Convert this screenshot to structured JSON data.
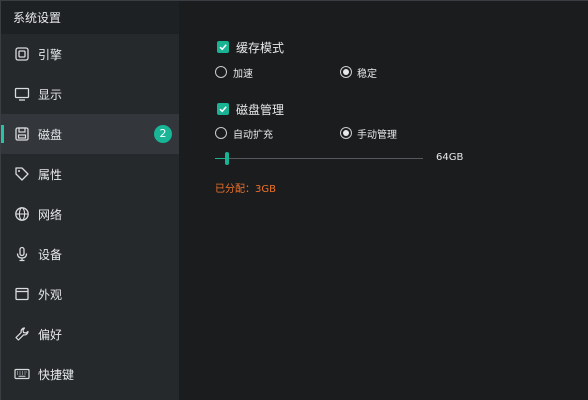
{
  "window": {
    "title": "系统设置"
  },
  "sidebar": {
    "items": [
      {
        "label": "引擎",
        "icon": "engine-icon"
      },
      {
        "label": "显示",
        "icon": "display-icon"
      },
      {
        "label": "磁盘",
        "icon": "disk-icon",
        "active": true,
        "badge": "2"
      },
      {
        "label": "属性",
        "icon": "tag-icon"
      },
      {
        "label": "网络",
        "icon": "globe-icon"
      },
      {
        "label": "设备",
        "icon": "microphone-icon"
      },
      {
        "label": "外观",
        "icon": "window-icon"
      },
      {
        "label": "偏好",
        "icon": "wrench-icon"
      },
      {
        "label": "快捷键",
        "icon": "keyboard-icon"
      }
    ]
  },
  "cache": {
    "label": "缓存模式",
    "checked": true,
    "options": [
      {
        "label": "加速",
        "selected": false
      },
      {
        "label": "稳定",
        "selected": true
      }
    ]
  },
  "disk_manage": {
    "label": "磁盘管理",
    "checked": true,
    "options": [
      {
        "label": "自动扩充",
        "selected": false
      },
      {
        "label": "手动管理",
        "selected": true
      }
    ],
    "slider_value": "64GB",
    "slider_fraction": 0.06,
    "allocated": "已分配：3GB"
  },
  "colors": {
    "accent": "#19b394",
    "warning": "#f0722a"
  }
}
